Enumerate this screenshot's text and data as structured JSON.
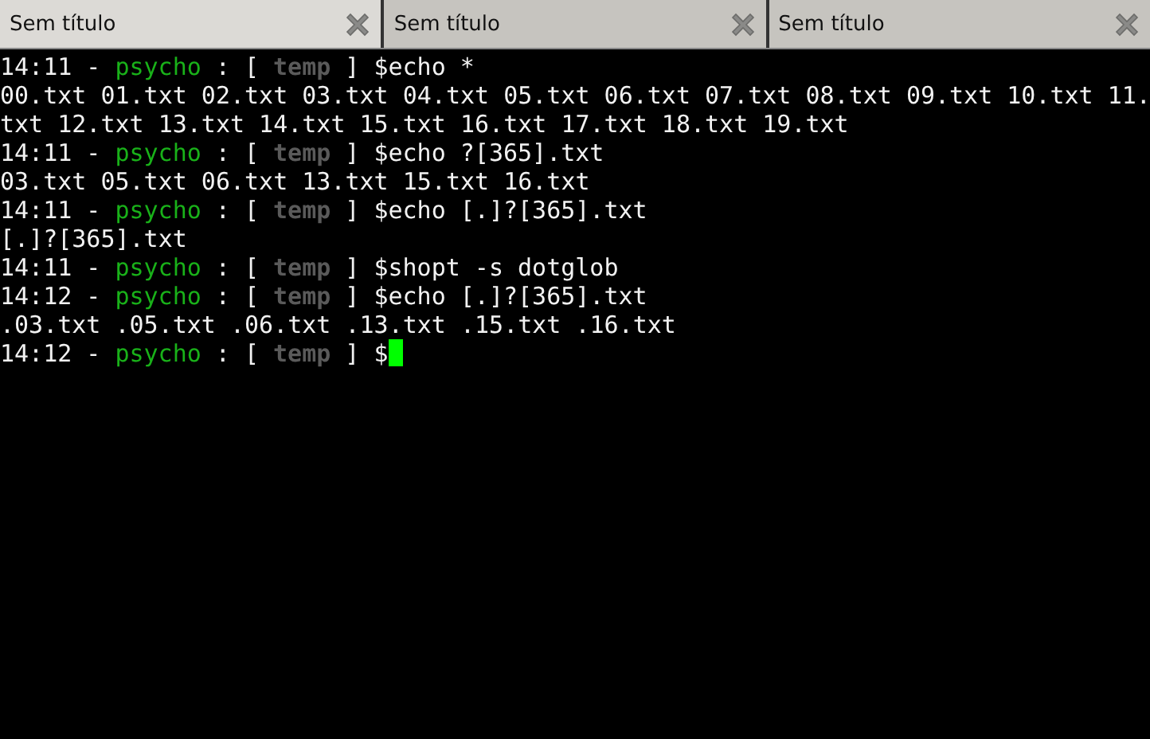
{
  "tabs": [
    {
      "label": "Sem título",
      "selected": true
    },
    {
      "label": "Sem título",
      "selected": false
    },
    {
      "label": "Sem título",
      "selected": false
    }
  ],
  "terminal": {
    "lines": [
      {
        "kind": "prompt",
        "time": "14:11",
        "dash": "-",
        "user": "psycho",
        "colon": ":",
        "open": "[",
        "dir": "temp",
        "close": "]",
        "command": "$echo *"
      },
      {
        "kind": "output",
        "text": "00.txt 01.txt 02.txt 03.txt 04.txt 05.txt 06.txt 07.txt 08.txt 09.txt 10.txt 11."
      },
      {
        "kind": "output",
        "text": "txt 12.txt 13.txt 14.txt 15.txt 16.txt 17.txt 18.txt 19.txt"
      },
      {
        "kind": "prompt",
        "time": "14:11",
        "dash": "-",
        "user": "psycho",
        "colon": ":",
        "open": "[",
        "dir": "temp",
        "close": "]",
        "command": "$echo ?[365].txt"
      },
      {
        "kind": "output",
        "text": "03.txt 05.txt 06.txt 13.txt 15.txt 16.txt"
      },
      {
        "kind": "prompt",
        "time": "14:11",
        "dash": "-",
        "user": "psycho",
        "colon": ":",
        "open": "[",
        "dir": "temp",
        "close": "]",
        "command": "$echo [.]?[365].txt"
      },
      {
        "kind": "output",
        "text": "[.]?[365].txt"
      },
      {
        "kind": "prompt",
        "time": "14:11",
        "dash": "-",
        "user": "psycho",
        "colon": ":",
        "open": "[",
        "dir": "temp",
        "close": "]",
        "command": "$shopt -s dotglob"
      },
      {
        "kind": "prompt",
        "time": "14:12",
        "dash": "-",
        "user": "psycho",
        "colon": ":",
        "open": "[",
        "dir": "temp",
        "close": "]",
        "command": "$echo [.]?[365].txt"
      },
      {
        "kind": "output",
        "text": ".03.txt .05.txt .06.txt .13.txt .15.txt .16.txt"
      },
      {
        "kind": "prompt",
        "time": "14:12",
        "dash": "-",
        "user": "psycho",
        "colon": ":",
        "open": "[",
        "dir": "temp",
        "close": "]",
        "command": "$",
        "cursor": true
      }
    ]
  }
}
